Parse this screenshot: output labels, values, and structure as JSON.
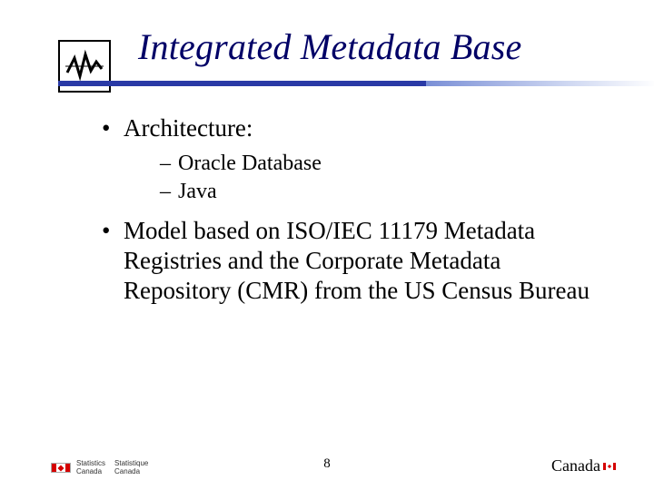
{
  "title": "Integrated Metadata Base",
  "bullets": {
    "b1_0": "Architecture:",
    "sub_0": "Oracle Database",
    "sub_1": "Java",
    "b1_1": "Model based on ISO/IEC 11179 Metadata Registries and the Corporate Metadata Repository (CMR) from the US Census Bureau"
  },
  "footer": {
    "page_number": "8",
    "stat_en_line1": "Statistics",
    "stat_en_line2": "Canada",
    "stat_fr_line1": "Statistique",
    "stat_fr_line2": "Canada",
    "wordmark": "Canada"
  }
}
